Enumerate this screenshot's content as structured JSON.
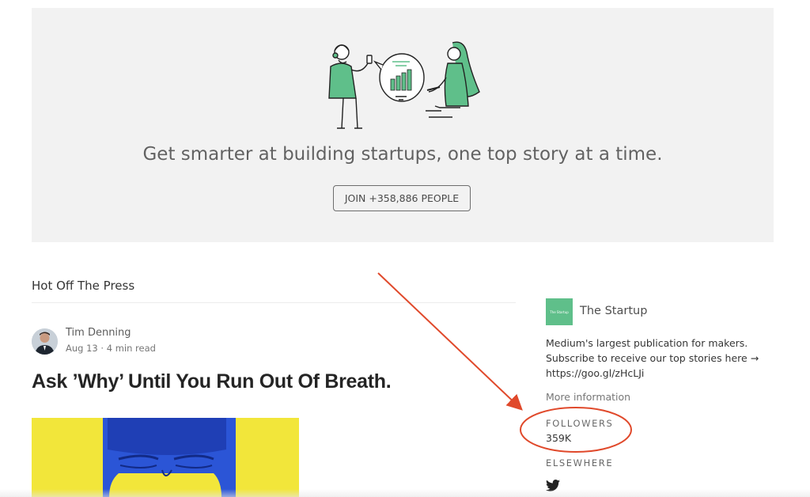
{
  "hero": {
    "title": "Get smarter at building startups, one top story at a time.",
    "join_label": "JOIN +358,886 PEOPLE"
  },
  "feed": {
    "section_title": "Hot Off The Press",
    "article": {
      "author": "Tim Denning",
      "date": "Aug 13",
      "separator": "·",
      "read_time": "4 min read",
      "title": "Ask ’Why’ Until You Run Out Of Breath."
    }
  },
  "sidebar": {
    "logo_text": "The Startup",
    "publication_name": "The Startup",
    "description": "Medium's largest publication for makers. Subscribe to receive our top stories here → https://goo.gl/zHcLJi",
    "more_info": "More information",
    "followers_label": "FOLLOWERS",
    "followers_count": "359K",
    "elsewhere_label": "ELSEWHERE"
  },
  "icons": {
    "twitter": "twitter-icon"
  },
  "colors": {
    "accent_green": "#5fbf8a",
    "annotation_red": "#e0492b",
    "hero_bg": "#f2f2f2"
  }
}
